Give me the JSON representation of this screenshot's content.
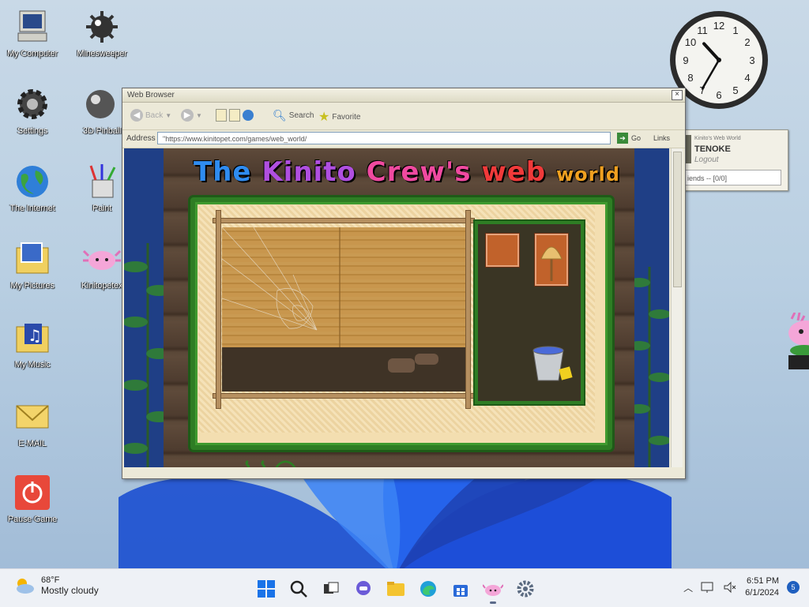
{
  "desktop": {
    "icons": [
      {
        "label": "My Computer"
      },
      {
        "label": "Minesweeper"
      },
      {
        "label": "Settings"
      },
      {
        "label": "3D Pinball"
      },
      {
        "label": "The Internet"
      },
      {
        "label": "Paint"
      },
      {
        "label": "My Pictures"
      },
      {
        "label": "Kinitopetex"
      },
      {
        "label": "My Music"
      },
      {
        "label": "E-MAIL"
      },
      {
        "label": "Pause Game"
      }
    ]
  },
  "clock": {
    "hour": 10,
    "minute": 35
  },
  "widget": {
    "small_text": "Kinito's Web World",
    "username": "TENOKE",
    "logout": "Logout",
    "friends": "iends -- [0/0]"
  },
  "browser": {
    "title": "Web Browser",
    "back_label": "Back",
    "search_label": "Search",
    "favorite_label": "Favorite",
    "address_label": "Address",
    "url": "\"https://www.kinitopet.com/games/web_world/",
    "go_label": "Go",
    "links_label": "Links"
  },
  "game": {
    "title_parts": [
      "The",
      "Kinito",
      "Crew's",
      "web",
      "world"
    ],
    "colors": {
      "the": "#2f8cf0",
      "kinito": "#b04fe0",
      "crews": "#f04aa0",
      "web": "#f03a3a",
      "world": "#f0a020"
    }
  },
  "taskbar": {
    "temp": "68°F",
    "weather": "Mostly cloudy",
    "time": "6:51 PM",
    "date": "6/1/2024",
    "notifications": "5"
  }
}
